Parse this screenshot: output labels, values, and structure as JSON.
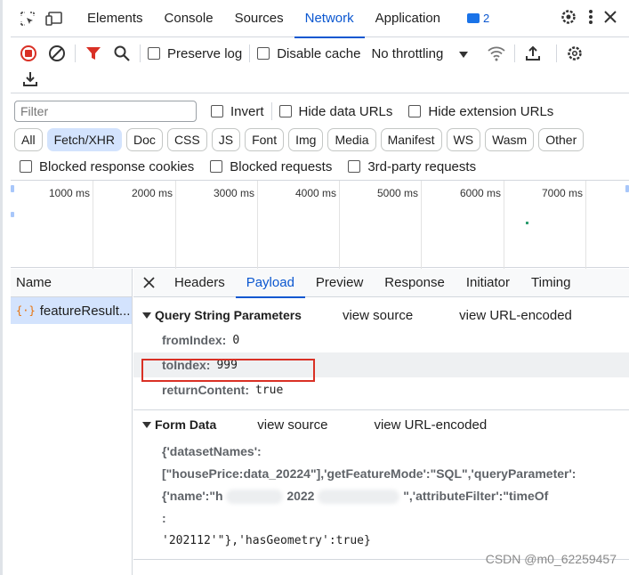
{
  "tabs": {
    "items": [
      "Elements",
      "Console",
      "Sources",
      "Network",
      "Application"
    ],
    "active": "Network",
    "issues_count": "2"
  },
  "toolbar": {
    "preserve_log": "Preserve log",
    "disable_cache": "Disable cache",
    "throttling": "No throttling"
  },
  "filter": {
    "placeholder": "Filter",
    "invert": "Invert",
    "hide_data_urls": "Hide data URLs",
    "hide_extension_urls": "Hide extension URLs"
  },
  "types": [
    "All",
    "Fetch/XHR",
    "Doc",
    "CSS",
    "JS",
    "Font",
    "Img",
    "Media",
    "Manifest",
    "WS",
    "Wasm",
    "Other"
  ],
  "active_type": "Fetch/XHR",
  "blocking": {
    "blocked_cookies": "Blocked response cookies",
    "blocked_requests": "Blocked requests",
    "third_party": "3rd-party requests"
  },
  "overview": {
    "ticks": [
      "1000 ms",
      "2000 ms",
      "3000 ms",
      "4000 ms",
      "5000 ms",
      "6000 ms",
      "7000 ms"
    ]
  },
  "requests": {
    "header": "Name",
    "rows": [
      {
        "name": "featureResult..."
      }
    ]
  },
  "detail": {
    "tabs": [
      "Headers",
      "Payload",
      "Preview",
      "Response",
      "Initiator",
      "Timing"
    ],
    "active": "Payload"
  },
  "payload": {
    "query_title": "Query String Parameters",
    "view_source": "view source",
    "view_url_encoded": "view URL-encoded",
    "params": [
      {
        "key": "fromIndex:",
        "value": "0"
      },
      {
        "key": "toIndex:",
        "value": "999"
      },
      {
        "key": "returnContent:",
        "value": "true"
      }
    ],
    "form_title": "Form Data",
    "form_lines": {
      "l1": "{'datasetNames':",
      "l2": "[\"housePrice:data_20224\"],'getFeatureMode':\"SQL\",'queryParameter':",
      "l3a": "{'name':\"h",
      "l3b": "2022",
      "l3c": "\",'attributeFilter':\"timeOf",
      "l4": ":",
      "l5": "'202112'\"},'hasGeometry':true}"
    }
  },
  "watermark": "CSDN @m0_62259457",
  "colors": {
    "accent": "#0b57d0",
    "highlight": "#d93025",
    "selection": "#d3e3fd"
  }
}
